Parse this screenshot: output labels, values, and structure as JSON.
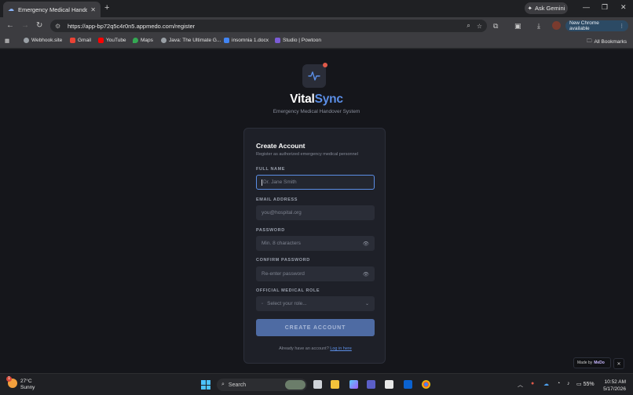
{
  "browser": {
    "tab_title": "Emergency Medical Handover",
    "tab_close": "✕",
    "new_tab": "+",
    "ask_gemini": "Ask Gemini",
    "url": "https://app-bp72q5c4r0n5.appmedo.com/register",
    "update_label": "New Chrome available",
    "bookmarks": [
      {
        "label": "Webhook.site",
        "color": "#9aa0a6"
      },
      {
        "label": "Gmail",
        "color": "#ea4335"
      },
      {
        "label": "YouTube",
        "color": "#ff0000"
      },
      {
        "label": "Maps",
        "color": "#34a853"
      },
      {
        "label": "Java: The Ultimate G...",
        "color": "#9aa0a6"
      },
      {
        "label": "insomnia 1.docx",
        "color": "#4285f4"
      },
      {
        "label": "Studio | Powtoon",
        "color": "#7b5cd6"
      }
    ],
    "all_bookmarks": "All Bookmarks"
  },
  "app": {
    "brand_part1": "Vital",
    "brand_part2": "Sync",
    "subtitle": "Emergency Medical Handover System"
  },
  "form": {
    "title": "Create Account",
    "subtitle": "Register as authorized emergency medical personnel",
    "full_name_label": "FULL NAME",
    "full_name_placeholder": "Dr. Jane Smith",
    "email_label": "EMAIL ADDRESS",
    "email_placeholder": "you@hospital.org",
    "password_label": "PASSWORD",
    "password_placeholder": "Min. 8 characters",
    "confirm_label": "CONFIRM PASSWORD",
    "confirm_placeholder": "Re-enter password",
    "role_label": "OFFICIAL MEDICAL ROLE",
    "role_placeholder": "Select your role...",
    "submit_label": "CREATE ACCOUNT",
    "login_prompt": "Already have an account?",
    "login_link": "Log in here"
  },
  "badge": {
    "made_by": "Made by",
    "brand": "MeDo",
    "close": "✕"
  },
  "taskbar": {
    "temperature": "27°C",
    "condition": "Sunny",
    "notification_count": "1",
    "search_label": "Search",
    "battery": "55%",
    "time": "10:52 AM",
    "date": "5/17/2026"
  }
}
